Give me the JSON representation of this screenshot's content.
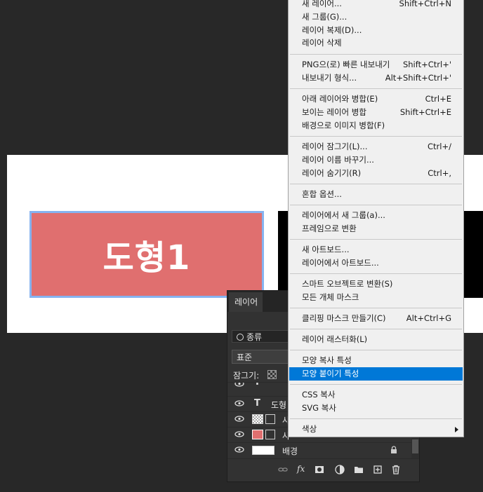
{
  "canvas": {
    "shape_text": "도형1"
  },
  "layers_panel": {
    "tab": "레이어",
    "search": "종류",
    "blend_mode": "표준",
    "lock_label": "잠그기:",
    "layers": [
      {
        "name": "",
        "kind": "text",
        "partial": true
      },
      {
        "name": "도형",
        "kind": "text"
      },
      {
        "name": "사",
        "kind": "shape"
      },
      {
        "name": "사",
        "kind": "shape-selected"
      },
      {
        "name": "배경",
        "kind": "background"
      }
    ]
  },
  "menu": {
    "items": [
      {
        "label": "새 레이어...",
        "shortcut": "Shift+Ctrl+N"
      },
      {
        "label": "새 그룹(G)...",
        "shortcut": ""
      },
      {
        "label": "레이어 복제(D)...",
        "shortcut": ""
      },
      {
        "label": "레이어 삭제",
        "shortcut": ""
      },
      {
        "label": "PNG으(로) 빠른 내보내기",
        "shortcut": "Shift+Ctrl+'"
      },
      {
        "label": "내보내기 형식...",
        "shortcut": "Alt+Shift+Ctrl+'"
      },
      {
        "label": "아래 레이어와 병합(E)",
        "shortcut": "Ctrl+E"
      },
      {
        "label": "보이는 레이어 병합",
        "shortcut": "Shift+Ctrl+E"
      },
      {
        "label": "배경으로 이미지 병합(F)",
        "shortcut": ""
      },
      {
        "label": "레이어 잠그기(L)...",
        "shortcut": "Ctrl+/"
      },
      {
        "label": "레이어 이름 바꾸기...",
        "shortcut": ""
      },
      {
        "label": "레이어 숨기기(R)",
        "shortcut": "Ctrl+,"
      },
      {
        "label": "혼합 옵션...",
        "shortcut": ""
      },
      {
        "label": "레이어에서 새 그룹(a)...",
        "shortcut": ""
      },
      {
        "label": "프레임으로 변환",
        "shortcut": ""
      },
      {
        "label": "새 아트보드...",
        "shortcut": ""
      },
      {
        "label": "레이어에서 아트보드...",
        "shortcut": ""
      },
      {
        "label": "스마트 오브젝트로 변환(S)",
        "shortcut": ""
      },
      {
        "label": "모든 개체 마스크",
        "shortcut": ""
      },
      {
        "label": "클리핑 마스크 만들기(C)",
        "shortcut": "Alt+Ctrl+G"
      },
      {
        "label": "레이어 래스터화(L)",
        "shortcut": ""
      },
      {
        "label": "모양 복사 특성",
        "shortcut": ""
      },
      {
        "label": "모양 붙이기 특성",
        "shortcut": "",
        "highlighted": true
      },
      {
        "label": "CSS 복사",
        "shortcut": ""
      },
      {
        "label": "SVG 복사",
        "shortcut": ""
      },
      {
        "label": "색상",
        "shortcut": "",
        "submenu": true
      }
    ]
  },
  "colors": {
    "accent": "#0078d7",
    "shape_fill": "#e06f6f",
    "shape_border": "#86b3f0"
  }
}
